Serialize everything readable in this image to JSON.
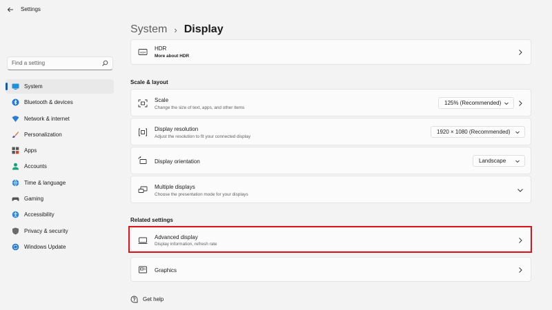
{
  "app": {
    "title": "Settings",
    "back_icon": "back-arrow-icon"
  },
  "search": {
    "placeholder": "Find a setting",
    "icon": "search-icon"
  },
  "sidebar": {
    "items": [
      {
        "label": "System",
        "icon": "system-icon",
        "active": true
      },
      {
        "label": "Bluetooth & devices",
        "icon": "bluetooth-icon"
      },
      {
        "label": "Network & internet",
        "icon": "wifi-icon"
      },
      {
        "label": "Personalization",
        "icon": "brush-icon"
      },
      {
        "label": "Apps",
        "icon": "apps-icon"
      },
      {
        "label": "Accounts",
        "icon": "person-icon"
      },
      {
        "label": "Time & language",
        "icon": "globe-icon"
      },
      {
        "label": "Gaming",
        "icon": "gamepad-icon"
      },
      {
        "label": "Accessibility",
        "icon": "accessibility-icon"
      },
      {
        "label": "Privacy & security",
        "icon": "shield-icon"
      },
      {
        "label": "Windows Update",
        "icon": "update-icon"
      }
    ]
  },
  "breadcrumb": {
    "parent": "System",
    "separator": "›",
    "current": "Display"
  },
  "hdr": {
    "title": "HDR",
    "subtitle": "More about HDR"
  },
  "scale_layout": {
    "heading": "Scale & layout",
    "scale": {
      "title": "Scale",
      "subtitle": "Change the size of text, apps, and other items",
      "value": "125% (Recommended)"
    },
    "resolution": {
      "title": "Display resolution",
      "subtitle": "Adjust the resolution to fit your connected display",
      "value": "1920 × 1080 (Recommended)"
    },
    "orientation": {
      "title": "Display orientation",
      "value": "Landscape"
    },
    "multiple": {
      "title": "Multiple displays",
      "subtitle": "Choose the presentation mode for your displays"
    }
  },
  "related": {
    "heading": "Related settings",
    "advanced": {
      "title": "Advanced display",
      "subtitle": "Display information, refresh rate"
    },
    "graphics": {
      "title": "Graphics"
    }
  },
  "help": {
    "label": "Get help"
  },
  "colors": {
    "accent": "#005fb8",
    "highlight": "#d9141b",
    "background": "#f3f3f3"
  }
}
